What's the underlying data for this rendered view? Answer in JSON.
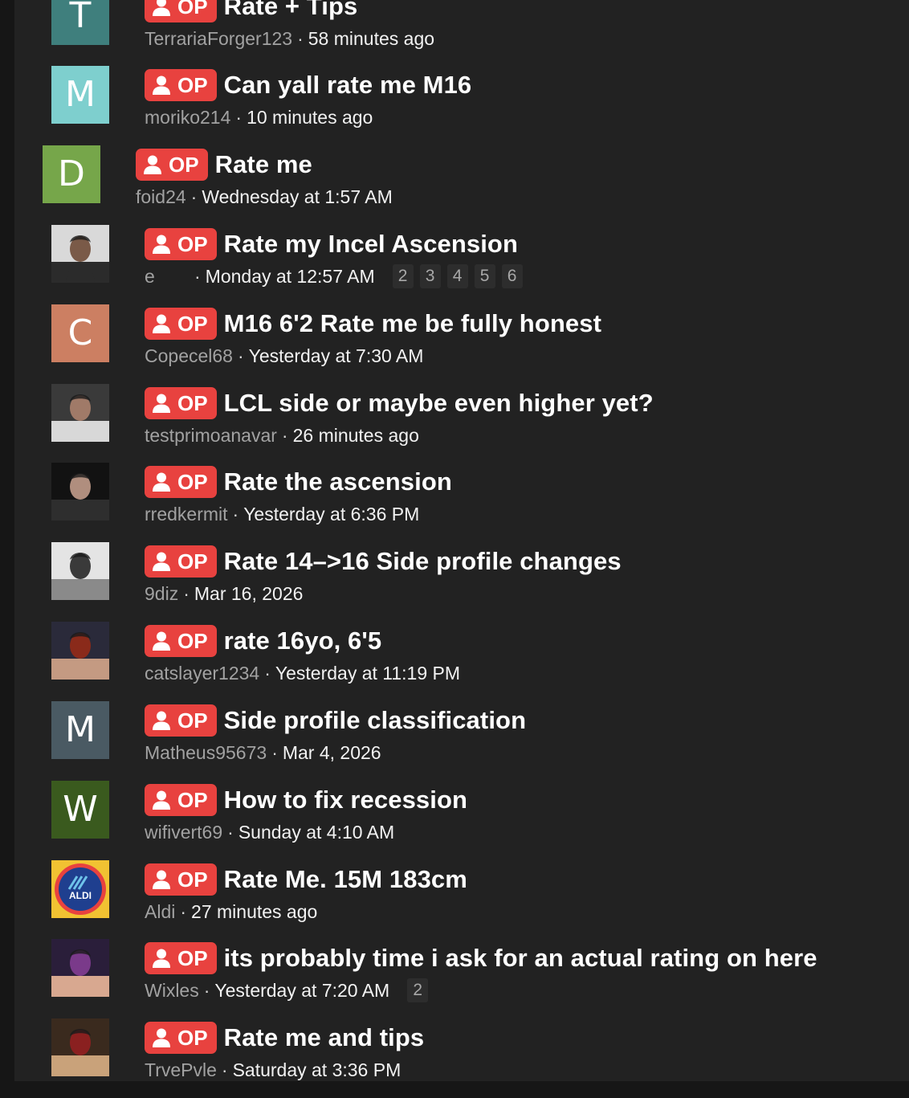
{
  "op_badge_label": "OP",
  "separator": "·",
  "colors": {
    "background": "#161616",
    "panel": "#222222",
    "op_badge": "#e8423f",
    "author": "#a2a2a2",
    "date": "#f2f2f2"
  },
  "threads": [
    {
      "title": "Rate + Tips",
      "author": "TerrariaForger123",
      "date": "58 minutes ago",
      "avatar": {
        "type": "letter",
        "letter": "T",
        "bg": "#3f7f7d"
      },
      "pages": []
    },
    {
      "title": "Can yall rate me M16",
      "author": "moriko214",
      "date": "10 minutes ago",
      "avatar": {
        "type": "letter",
        "letter": "M",
        "bg": "#7ecfce"
      },
      "pages": []
    },
    {
      "title": "Rate me",
      "author": "foid24",
      "date": "Wednesday at 1:57 AM",
      "avatar": {
        "type": "letter",
        "letter": "D",
        "bg": "#76a64a"
      },
      "pages": []
    },
    {
      "title": "Rate my Incel Ascension",
      "author": "e",
      "date": "Monday at 12:57 AM",
      "avatar": {
        "type": "photo",
        "icon": "profile-photo-icon"
      },
      "pages": [
        "2",
        "3",
        "4",
        "5",
        "6"
      ]
    },
    {
      "title": "M16 6'2 Rate me be fully honest",
      "author": "Copecel68",
      "date": "Yesterday at 7:30 AM",
      "avatar": {
        "type": "letter",
        "letter": "C",
        "bg": "#cc7f62"
      },
      "pages": []
    },
    {
      "title": "LCL side or maybe even higher yet?",
      "author": "testprimoanavar",
      "date": "26 minutes ago",
      "avatar": {
        "type": "photo",
        "icon": "profile-photo-icon"
      },
      "pages": []
    },
    {
      "title": "Rate the ascension",
      "author": "rredkermit",
      "date": "Yesterday at 6:36 PM",
      "avatar": {
        "type": "photo",
        "icon": "profile-photo-icon"
      },
      "pages": []
    },
    {
      "title": "Rate 14–>16 Side profile changes",
      "author": "9diz",
      "date": "Mar 16, 2026",
      "avatar": {
        "type": "photo",
        "icon": "profile-photo-icon"
      },
      "pages": []
    },
    {
      "title": "rate 16yo, 6'5",
      "author": "catslayer1234",
      "date": "Yesterday at 11:19 PM",
      "avatar": {
        "type": "photo",
        "icon": "profile-photo-icon"
      },
      "pages": []
    },
    {
      "title": "Side profile classification",
      "author": "Matheus95673",
      "date": "Mar 4, 2026",
      "avatar": {
        "type": "letter",
        "letter": "M",
        "bg": "#4a5a63"
      },
      "pages": []
    },
    {
      "title": "How to fix recession",
      "author": "wifivert69",
      "date": "Sunday at 4:10 AM",
      "avatar": {
        "type": "letter",
        "letter": "W",
        "bg": "#3a5a1e"
      },
      "pages": []
    },
    {
      "title": "Rate Me. 15M 183cm",
      "author": "Aldi",
      "date": "27 minutes ago",
      "avatar": {
        "type": "logo",
        "icon": "aldi-logo-icon",
        "logo_text": "ALDI"
      },
      "pages": []
    },
    {
      "title": "its probably time i ask for an actual rating on here",
      "author": "Wixles",
      "date": "Yesterday at 7:20 AM",
      "avatar": {
        "type": "photo",
        "icon": "profile-photo-icon"
      },
      "pages": [
        "2"
      ]
    },
    {
      "title": "Rate me and tips",
      "author": "TrvePvle",
      "date": "Saturday at 3:36 PM",
      "avatar": {
        "type": "photo",
        "icon": "profile-photo-icon"
      },
      "pages": []
    }
  ]
}
